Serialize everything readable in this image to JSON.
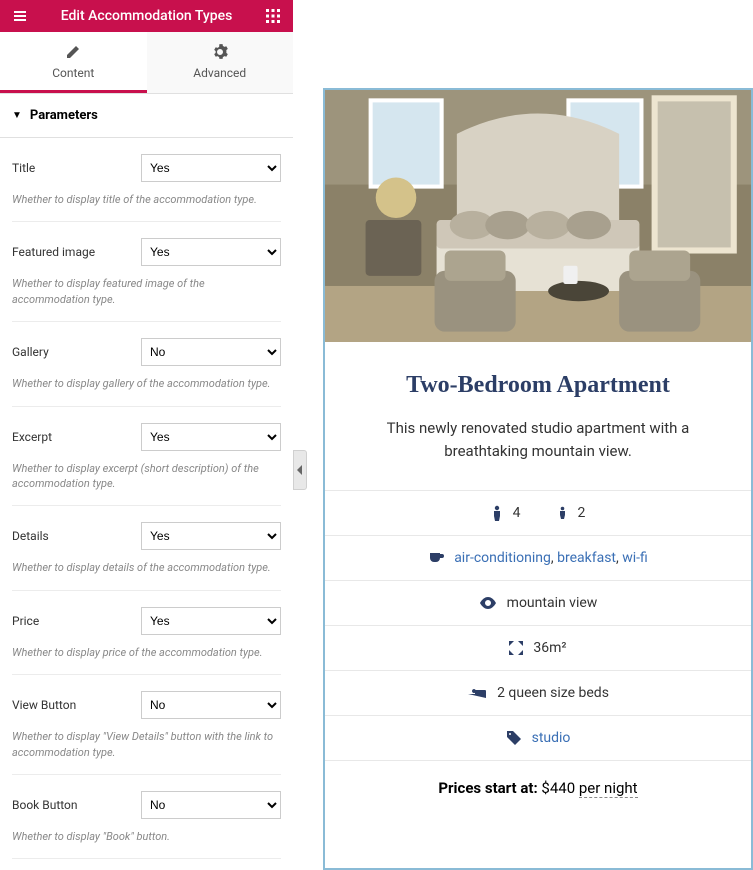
{
  "header": {
    "title": "Edit Accommodation Types"
  },
  "tabs": {
    "content": "Content",
    "advanced": "Advanced"
  },
  "panel": {
    "title": "Parameters"
  },
  "fields": [
    {
      "label": "Title",
      "value": "Yes",
      "help": "Whether to display title of the accommodation type."
    },
    {
      "label": "Featured image",
      "value": "Yes",
      "help": "Whether to display featured image of the accommodation type."
    },
    {
      "label": "Gallery",
      "value": "No",
      "help": "Whether to display gallery of the accommodation type."
    },
    {
      "label": "Excerpt",
      "value": "Yes",
      "help": "Whether to display excerpt (short description) of the accommodation type."
    },
    {
      "label": "Details",
      "value": "Yes",
      "help": "Whether to display details of the accommodation type."
    },
    {
      "label": "Price",
      "value": "Yes",
      "help": "Whether to display price of the accommodation type."
    },
    {
      "label": "View Button",
      "value": "No",
      "help": "Whether to display \"View Details\" button with the link to accommodation type."
    },
    {
      "label": "Book Button",
      "value": "No",
      "help": "Whether to display \"Book\" button."
    }
  ],
  "preview": {
    "title": "Two-Bedroom Apartment",
    "excerpt": "This newly renovated studio apartment with a breathtaking mountain view.",
    "adults": "4",
    "children": "2",
    "amenities": {
      "a1": "air-conditioning",
      "a2": "breakfast",
      "a3": "wi-fi"
    },
    "view": "mountain view",
    "size": "36m²",
    "beds": "2 queen size beds",
    "tag": "studio",
    "price_label": "Prices start at:",
    "price_value": "$440",
    "price_per": "per night"
  }
}
